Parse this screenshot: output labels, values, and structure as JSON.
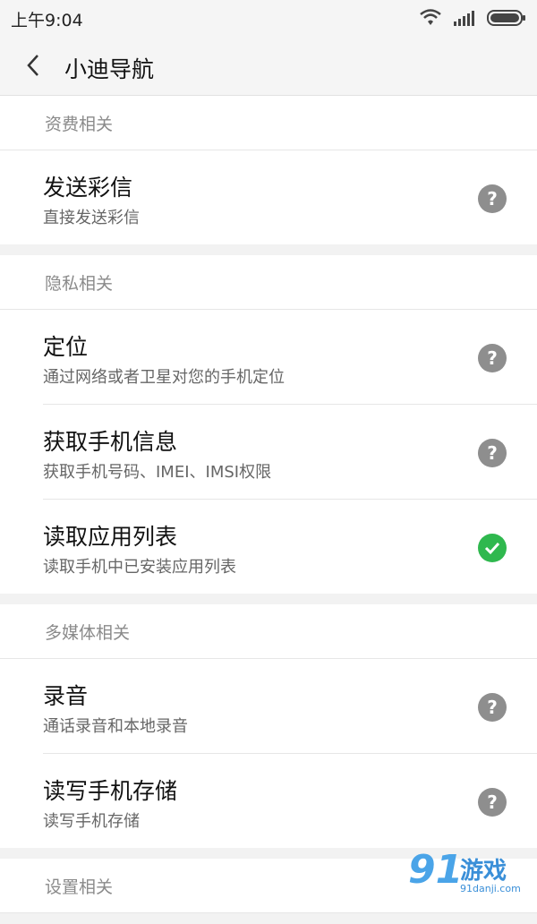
{
  "status_bar": {
    "time": "上午9:04"
  },
  "app_bar": {
    "title": "小迪导航"
  },
  "sections": [
    {
      "header": "资费相关",
      "items": [
        {
          "title": "发送彩信",
          "desc": "直接发送彩信",
          "status": "help"
        }
      ]
    },
    {
      "header": "隐私相关",
      "items": [
        {
          "title": "定位",
          "desc": "通过网络或者卫星对您的手机定位",
          "status": "help"
        },
        {
          "title": "获取手机信息",
          "desc": "获取手机号码、IMEI、IMSI权限",
          "status": "help"
        },
        {
          "title": "读取应用列表",
          "desc": "读取手机中已安装应用列表",
          "status": "check"
        }
      ]
    },
    {
      "header": "多媒体相关",
      "items": [
        {
          "title": "录音",
          "desc": "通话录音和本地录音",
          "status": "help"
        },
        {
          "title": "读写手机存储",
          "desc": "读写手机存储",
          "status": "help"
        }
      ]
    },
    {
      "header": "设置相关",
      "items": []
    }
  ],
  "icons": {
    "help": "question-mark",
    "check": "check-mark"
  },
  "colors": {
    "help": "#8e8e8e",
    "check": "#2fb84e"
  },
  "watermark": {
    "number": "91",
    "text": "游戏",
    "url": "91danji.com"
  }
}
